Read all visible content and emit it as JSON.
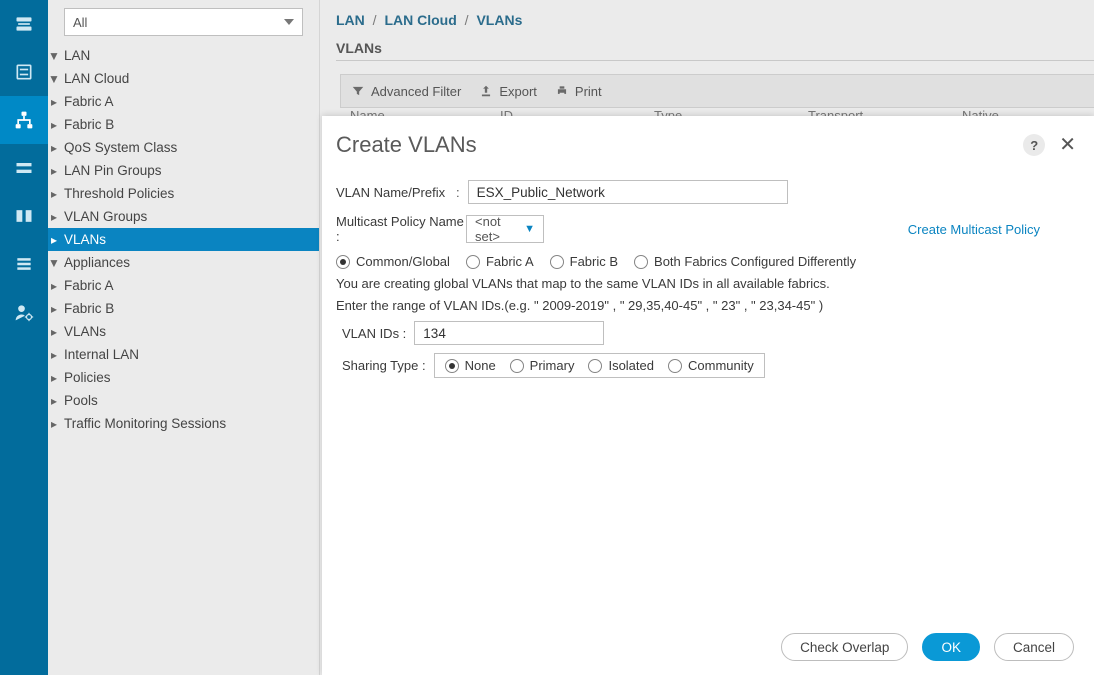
{
  "filter_select": {
    "value": "All"
  },
  "breadcrumb": {
    "a": "LAN",
    "b": "LAN Cloud",
    "c": "VLANs"
  },
  "section_title": "VLANs",
  "toolbar": {
    "adv_filter": "Advanced Filter",
    "export": "Export",
    "print": "Print"
  },
  "table_cols": {
    "c1": "Name",
    "c2": "ID",
    "c3": "Type",
    "c4": "Transport",
    "c5": "Native"
  },
  "tree": {
    "lan": "LAN",
    "lan_cloud": "LAN Cloud",
    "fabric_a": "Fabric A",
    "fabric_b": "Fabric B",
    "qos": "QoS System Class",
    "pin_groups": "LAN Pin Groups",
    "threshold": "Threshold Policies",
    "vlan_groups": "VLAN Groups",
    "vlans": "VLANs",
    "appliances": "Appliances",
    "app_fabric_a": "Fabric A",
    "app_fabric_b": "Fabric B",
    "app_vlans": "VLANs",
    "internal_lan": "Internal LAN",
    "policies": "Policies",
    "pools": "Pools",
    "traffic": "Traffic Monitoring Sessions"
  },
  "dialog": {
    "title": "Create VLANs",
    "help": "?",
    "name_lbl": "VLAN Name/Prefix",
    "name_val": "ESX_Public_Network",
    "mcast_lbl": "Multicast Policy Name :",
    "mcast_val": "<not set>",
    "mcast_link": "Create Multicast Policy",
    "scope": {
      "common": "Common/Global",
      "fab_a": "Fabric A",
      "fab_b": "Fabric B",
      "both": "Both Fabrics Configured Differently"
    },
    "info1": "You are creating global VLANs that map to the same VLAN IDs in all available fabrics.",
    "info2": "Enter the range of VLAN IDs.(e.g. \" 2009-2019\" , \" 29,35,40-45\" , \" 23\" , \" 23,34-45\" )",
    "vlan_ids_lbl": "VLAN IDs :",
    "vlan_ids_val": "134",
    "sharing_lbl": "Sharing Type  :",
    "sharing": {
      "none": "None",
      "primary": "Primary",
      "isolated": "Isolated",
      "community": "Community"
    },
    "buttons": {
      "check": "Check Overlap",
      "ok": "OK",
      "cancel": "Cancel"
    }
  }
}
